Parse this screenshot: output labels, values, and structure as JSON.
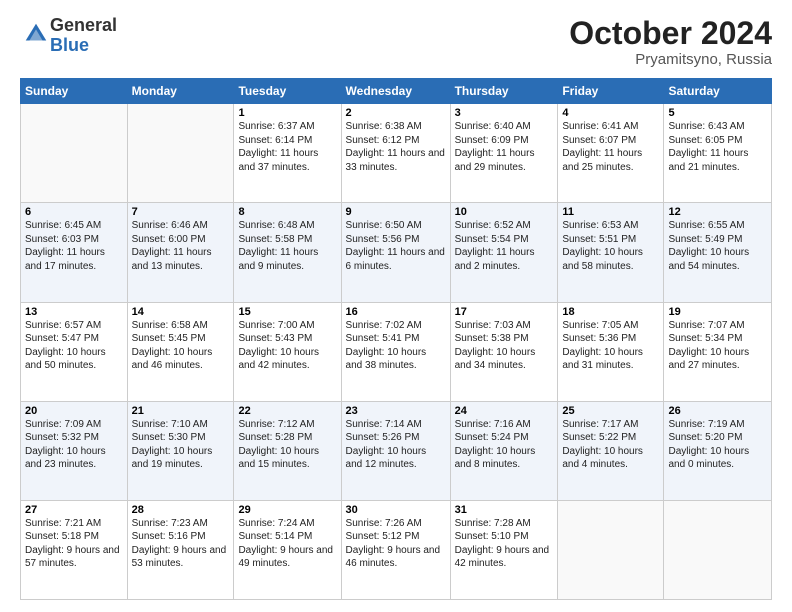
{
  "logo": {
    "general": "General",
    "blue": "Blue"
  },
  "title": "October 2024",
  "location": "Pryamitsyno, Russia",
  "days_header": [
    "Sunday",
    "Monday",
    "Tuesday",
    "Wednesday",
    "Thursday",
    "Friday",
    "Saturday"
  ],
  "weeks": [
    [
      {
        "day": "",
        "info": ""
      },
      {
        "day": "",
        "info": ""
      },
      {
        "day": "1",
        "info": "Sunrise: 6:37 AM\nSunset: 6:14 PM\nDaylight: 11 hours and 37 minutes."
      },
      {
        "day": "2",
        "info": "Sunrise: 6:38 AM\nSunset: 6:12 PM\nDaylight: 11 hours and 33 minutes."
      },
      {
        "day": "3",
        "info": "Sunrise: 6:40 AM\nSunset: 6:09 PM\nDaylight: 11 hours and 29 minutes."
      },
      {
        "day": "4",
        "info": "Sunrise: 6:41 AM\nSunset: 6:07 PM\nDaylight: 11 hours and 25 minutes."
      },
      {
        "day": "5",
        "info": "Sunrise: 6:43 AM\nSunset: 6:05 PM\nDaylight: 11 hours and 21 minutes."
      }
    ],
    [
      {
        "day": "6",
        "info": "Sunrise: 6:45 AM\nSunset: 6:03 PM\nDaylight: 11 hours and 17 minutes."
      },
      {
        "day": "7",
        "info": "Sunrise: 6:46 AM\nSunset: 6:00 PM\nDaylight: 11 hours and 13 minutes."
      },
      {
        "day": "8",
        "info": "Sunrise: 6:48 AM\nSunset: 5:58 PM\nDaylight: 11 hours and 9 minutes."
      },
      {
        "day": "9",
        "info": "Sunrise: 6:50 AM\nSunset: 5:56 PM\nDaylight: 11 hours and 6 minutes."
      },
      {
        "day": "10",
        "info": "Sunrise: 6:52 AM\nSunset: 5:54 PM\nDaylight: 11 hours and 2 minutes."
      },
      {
        "day": "11",
        "info": "Sunrise: 6:53 AM\nSunset: 5:51 PM\nDaylight: 10 hours and 58 minutes."
      },
      {
        "day": "12",
        "info": "Sunrise: 6:55 AM\nSunset: 5:49 PM\nDaylight: 10 hours and 54 minutes."
      }
    ],
    [
      {
        "day": "13",
        "info": "Sunrise: 6:57 AM\nSunset: 5:47 PM\nDaylight: 10 hours and 50 minutes."
      },
      {
        "day": "14",
        "info": "Sunrise: 6:58 AM\nSunset: 5:45 PM\nDaylight: 10 hours and 46 minutes."
      },
      {
        "day": "15",
        "info": "Sunrise: 7:00 AM\nSunset: 5:43 PM\nDaylight: 10 hours and 42 minutes."
      },
      {
        "day": "16",
        "info": "Sunrise: 7:02 AM\nSunset: 5:41 PM\nDaylight: 10 hours and 38 minutes."
      },
      {
        "day": "17",
        "info": "Sunrise: 7:03 AM\nSunset: 5:38 PM\nDaylight: 10 hours and 34 minutes."
      },
      {
        "day": "18",
        "info": "Sunrise: 7:05 AM\nSunset: 5:36 PM\nDaylight: 10 hours and 31 minutes."
      },
      {
        "day": "19",
        "info": "Sunrise: 7:07 AM\nSunset: 5:34 PM\nDaylight: 10 hours and 27 minutes."
      }
    ],
    [
      {
        "day": "20",
        "info": "Sunrise: 7:09 AM\nSunset: 5:32 PM\nDaylight: 10 hours and 23 minutes."
      },
      {
        "day": "21",
        "info": "Sunrise: 7:10 AM\nSunset: 5:30 PM\nDaylight: 10 hours and 19 minutes."
      },
      {
        "day": "22",
        "info": "Sunrise: 7:12 AM\nSunset: 5:28 PM\nDaylight: 10 hours and 15 minutes."
      },
      {
        "day": "23",
        "info": "Sunrise: 7:14 AM\nSunset: 5:26 PM\nDaylight: 10 hours and 12 minutes."
      },
      {
        "day": "24",
        "info": "Sunrise: 7:16 AM\nSunset: 5:24 PM\nDaylight: 10 hours and 8 minutes."
      },
      {
        "day": "25",
        "info": "Sunrise: 7:17 AM\nSunset: 5:22 PM\nDaylight: 10 hours and 4 minutes."
      },
      {
        "day": "26",
        "info": "Sunrise: 7:19 AM\nSunset: 5:20 PM\nDaylight: 10 hours and 0 minutes."
      }
    ],
    [
      {
        "day": "27",
        "info": "Sunrise: 7:21 AM\nSunset: 5:18 PM\nDaylight: 9 hours and 57 minutes."
      },
      {
        "day": "28",
        "info": "Sunrise: 7:23 AM\nSunset: 5:16 PM\nDaylight: 9 hours and 53 minutes."
      },
      {
        "day": "29",
        "info": "Sunrise: 7:24 AM\nSunset: 5:14 PM\nDaylight: 9 hours and 49 minutes."
      },
      {
        "day": "30",
        "info": "Sunrise: 7:26 AM\nSunset: 5:12 PM\nDaylight: 9 hours and 46 minutes."
      },
      {
        "day": "31",
        "info": "Sunrise: 7:28 AM\nSunset: 5:10 PM\nDaylight: 9 hours and 42 minutes."
      },
      {
        "day": "",
        "info": ""
      },
      {
        "day": "",
        "info": ""
      }
    ]
  ]
}
